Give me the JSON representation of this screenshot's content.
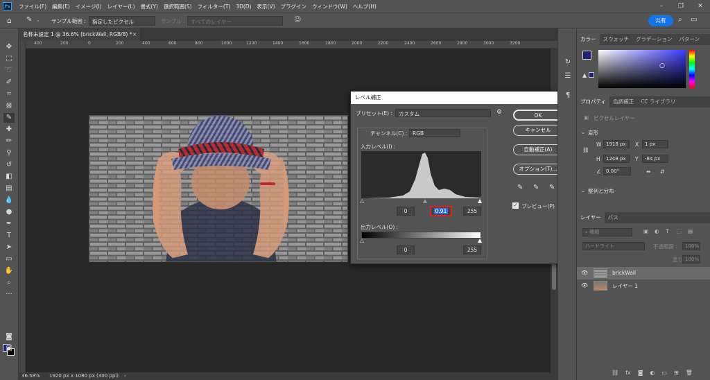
{
  "menu": [
    "ファイル(F)",
    "編集(E)",
    "イメージ(I)",
    "レイヤー(L)",
    "書式(Y)",
    "選択範囲(S)",
    "フィルター(T)",
    "3D(D)",
    "表示(V)",
    "プラグイン",
    "ウィンドウ(W)",
    "ヘルプ(H)"
  ],
  "app_logo": "Ps",
  "options": {
    "sample_label": "サンプル範囲 :",
    "sample_value": "指定したピクセル",
    "sample2_label": "サンプル :",
    "sample2_value": "すべてのレイヤー",
    "share": "共有"
  },
  "document": {
    "tab_title": "名称未設定 1 @ 36.6% (brickWall, RGB/8) *",
    "ruler_ticks": [
      "400",
      "200",
      "0",
      "200",
      "400",
      "600",
      "800",
      "1000",
      "1200",
      "1400",
      "1600",
      "1800",
      "2000",
      "2200",
      "2400",
      "2600",
      "2800",
      "3000",
      "3200"
    ],
    "zoom": "36.58%",
    "doc_info": "1920 px x 1080 px (300 ppi)"
  },
  "levels": {
    "title": "レベル補正",
    "preset_label": "プリセット(E) :",
    "preset_value": "カスタム",
    "channel_label": "チャンネル(C) :",
    "channel_value": "RGB",
    "input_label": "入力レベル(I) :",
    "input_black": "0",
    "input_gamma": "0.91",
    "input_white": "255",
    "output_label": "出力レベル(O) :",
    "output_black": "0",
    "output_white": "255",
    "ok": "OK",
    "cancel": "キャンセル",
    "auto": "自動補正(A)",
    "options": "オプション(T)...",
    "preview": "プレビュー(P)"
  },
  "panels": {
    "color_tabs": [
      "カラー",
      "スウォッチ",
      "グラデーション",
      "パターン"
    ],
    "prop_tabs": [
      "プロパティ",
      "色調補正",
      "CC ライブラリ"
    ],
    "pixel_layer": "ピクセルレイヤー",
    "transform": "変形",
    "w": "W",
    "w_value": "1918 px",
    "x": "X",
    "x_value": "1 px",
    "h": "H",
    "h_value": "1248 px",
    "y": "Y",
    "y_value": "-84 px",
    "angle_value": "0.00°",
    "align": "整列と分布",
    "layer_tabs": [
      "レイヤー",
      "パス"
    ],
    "kind": "種類",
    "blend": "ハードライト",
    "opacity_label": "不透明度 :",
    "opacity_value": "100%",
    "fill_label": "塗り :",
    "fill_value": "100%",
    "layers": [
      "brickWall",
      "レイヤー 1"
    ]
  },
  "colors": {
    "accent": "#1473e6",
    "highlight_box": "#e02020",
    "foreground": "#1f1f7a"
  }
}
